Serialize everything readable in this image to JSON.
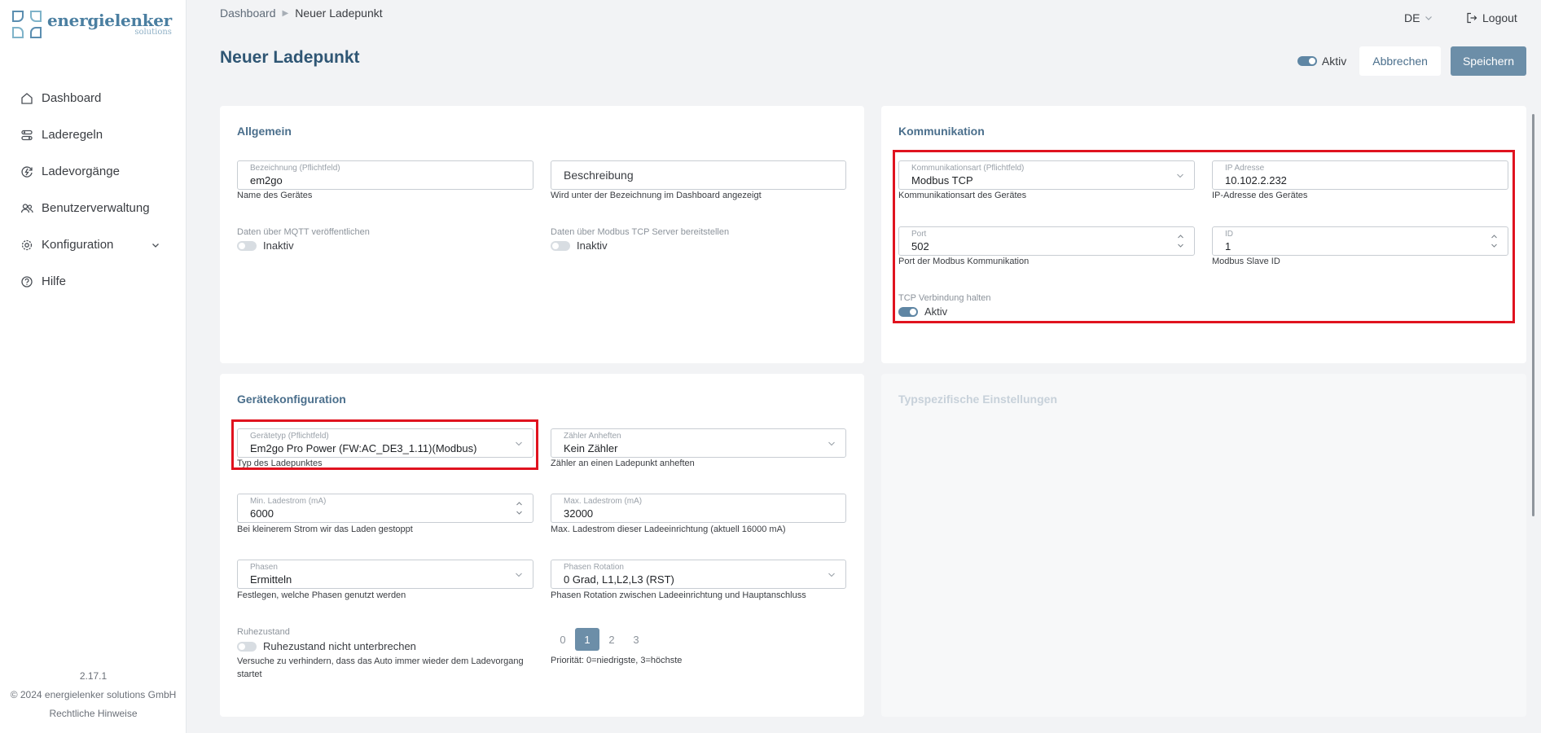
{
  "sidebar": {
    "logo": {
      "name": "energielenker",
      "sub": "solutions"
    },
    "items": [
      {
        "label": "Dashboard",
        "icon": "home-icon"
      },
      {
        "label": "Laderegeln",
        "icon": "rules-icon"
      },
      {
        "label": "Ladevorgänge",
        "icon": "charge-icon"
      },
      {
        "label": "Benutzerverwaltung",
        "icon": "users-icon"
      },
      {
        "label": "Konfiguration",
        "icon": "gear-icon"
      },
      {
        "label": "Hilfe",
        "icon": "help-icon"
      }
    ],
    "footer": {
      "version": "2.17.1",
      "copyright": "© 2024 energielenker solutions GmbH",
      "legal": "Rechtliche Hinweise"
    }
  },
  "header": {
    "breadcrumb": [
      "Dashboard",
      "Neuer Ladepunkt"
    ],
    "language": "DE",
    "logout": "Logout",
    "title": "Neuer Ladepunkt",
    "active_label": "Aktiv",
    "cancel_label": "Abbrechen",
    "save_label": "Speichern"
  },
  "allgemein": {
    "title": "Allgemein",
    "bezeichnung": {
      "label": "Bezeichnung (Pflichtfeld)",
      "value": "em2go",
      "hint": "Name des Gerätes"
    },
    "beschreibung": {
      "placeholder": "Beschreibung",
      "hint": "Wird unter der Bezeichnung im Dashboard angezeigt"
    },
    "mqtt": {
      "label": "Daten über MQTT veröffentlichen",
      "state": "Inaktiv"
    },
    "modbus_server": {
      "label": "Daten über Modbus TCP Server bereitstellen",
      "state": "Inaktiv"
    }
  },
  "kommunikation": {
    "title": "Kommunikation",
    "art": {
      "label": "Kommunikationsart (Pflichtfeld)",
      "value": "Modbus TCP",
      "hint": "Kommunikationsart des Gerätes"
    },
    "ip": {
      "label": "IP Adresse",
      "value": "10.102.2.232",
      "hint": "IP-Adresse des Gerätes"
    },
    "port": {
      "label": "Port",
      "value": "502",
      "hint": "Port der Modbus Kommunikation"
    },
    "id": {
      "label": "ID",
      "value": "1",
      "hint": "Modbus Slave ID"
    },
    "tcp": {
      "label": "TCP Verbindung halten",
      "state": "Aktiv"
    }
  },
  "geraet": {
    "title": "Gerätekonfiguration",
    "typ": {
      "label": "Gerätetyp (Pflichtfeld)",
      "value": "Em2go Pro Power (FW:AC_DE3_1.11)(Modbus)",
      "hint": "Typ des Ladepunktes"
    },
    "zaehler": {
      "label": "Zähler Anheften",
      "value": "Kein Zähler",
      "hint": "Zähler an einen Ladepunkt anheften"
    },
    "min": {
      "label": "Min. Ladestrom (mA)",
      "value": "6000",
      "hint": "Bei kleinerem Strom wir das Laden gestoppt"
    },
    "max": {
      "label": "Max. Ladestrom (mA)",
      "value": "32000",
      "hint": "Max. Ladestrom dieser Ladeeinrichtung (aktuell 16000 mA)"
    },
    "phasen": {
      "label": "Phasen",
      "value": "Ermitteln",
      "hint": "Festlegen, welche Phasen genutzt werden"
    },
    "rotation": {
      "label": "Phasen Rotation",
      "value": "0 Grad, L1,L2,L3 (RST)",
      "hint": "Phasen Rotation zwischen Ladeeinrichtung und Hauptanschluss"
    },
    "ruhe": {
      "label": "Ruhezustand",
      "state": "Ruhezustand nicht unterbrechen",
      "hint1": "Versuche zu verhindern, dass das Auto immer wieder dem Ladevorgang",
      "hint2": "startet"
    },
    "prio": {
      "options": [
        "0",
        "1",
        "2",
        "3"
      ],
      "selected": "1",
      "hint": "Priorität: 0=niedrigste, 3=höchste"
    }
  },
  "typspezifisch": {
    "title": "Typspezifische Einstellungen"
  }
}
